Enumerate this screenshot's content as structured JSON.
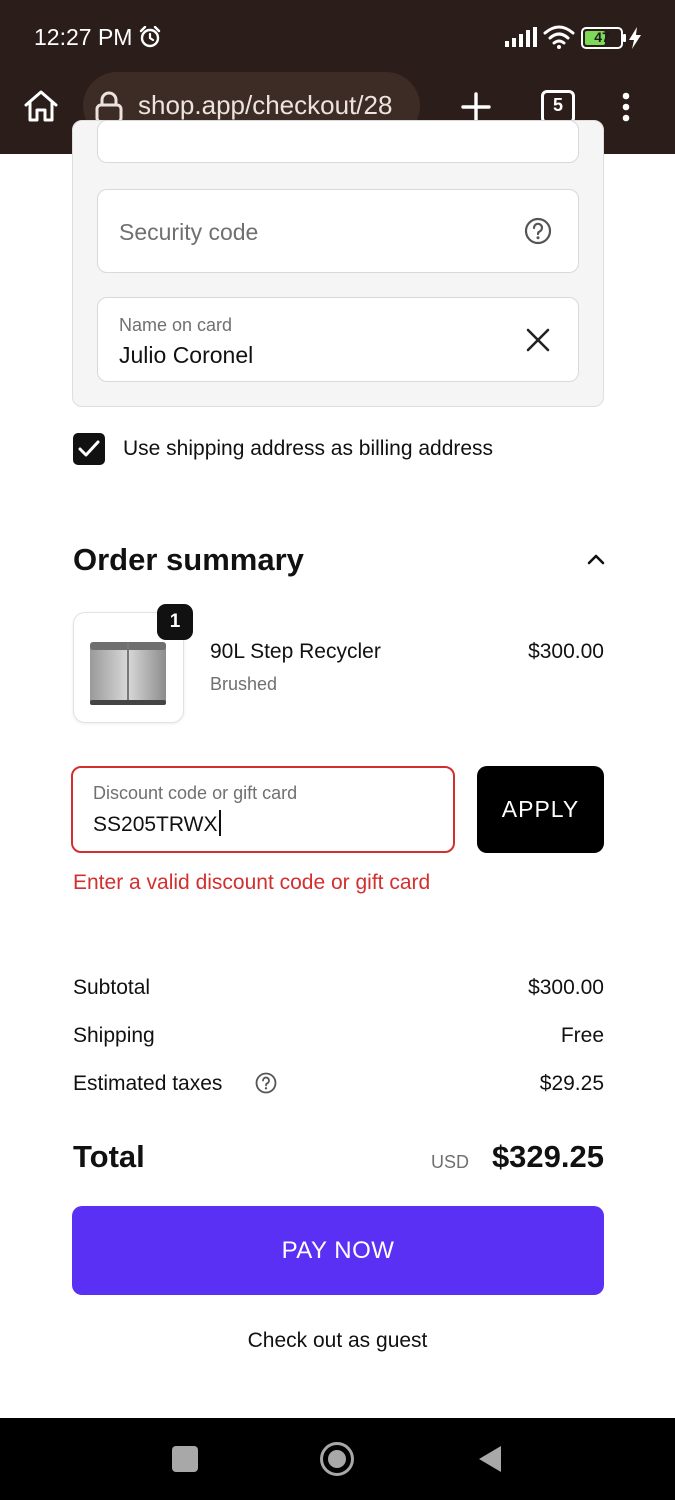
{
  "status_bar": {
    "time": "12:27 PM",
    "battery": "47",
    "icons": [
      "alarm-icon",
      "signal-icon",
      "wifi-icon",
      "battery-icon",
      "charge-icon"
    ]
  },
  "browser": {
    "url": "shop.app/checkout/28",
    "tab_count": "5",
    "icons": [
      "home-icon",
      "lock-icon",
      "new-tab-icon",
      "tabs-icon",
      "menu-icon"
    ]
  },
  "payment": {
    "security_code_placeholder": "Security code",
    "name_label": "Name on card",
    "name_value": "Julio Coronel",
    "billing_checkbox_label": "Use shipping address as billing address",
    "billing_checked": true
  },
  "order_summary": {
    "title": "Order summary",
    "item": {
      "name": "90L Step Recycler",
      "variant": "Brushed",
      "price": "$300.00",
      "quantity": "1"
    },
    "discount": {
      "label": "Discount code or gift card",
      "value": "SS205TRWX",
      "apply_label": "APPLY",
      "error": "Enter a valid discount code or gift card"
    },
    "rows": {
      "subtotal_label": "Subtotal",
      "subtotal_value": "$300.00",
      "shipping_label": "Shipping",
      "shipping_value": "Free",
      "taxes_label": "Estimated taxes",
      "taxes_value": "$29.25"
    },
    "total_label": "Total",
    "total_currency": "USD",
    "total_value": "$329.25",
    "pay_label": "PAY NOW",
    "guest_label": "Check out as guest"
  },
  "colors": {
    "browser_chrome": "#2a1d1a",
    "pay_button": "#5a31f4",
    "error": "#d32f2f"
  }
}
